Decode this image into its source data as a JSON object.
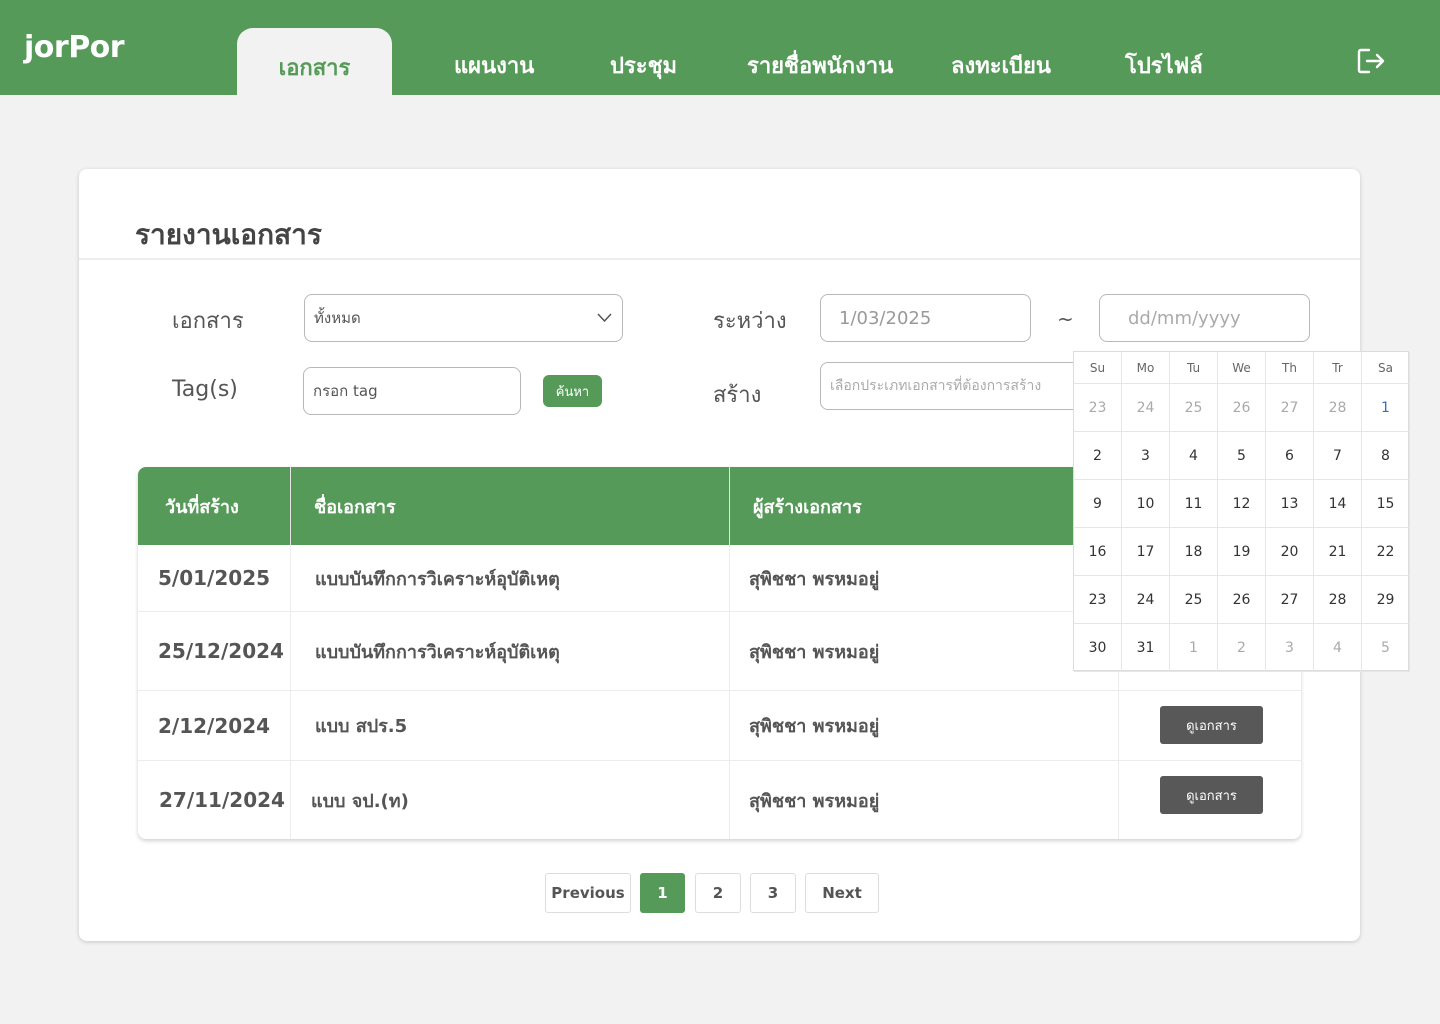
{
  "app": {
    "logo": "jorPor"
  },
  "nav": {
    "tabs": [
      {
        "label": "เอกสาร",
        "active": true
      },
      {
        "label": "แผนงาน"
      },
      {
        "label": "ประชุม"
      },
      {
        "label": "รายชื่อพนักงาน"
      },
      {
        "label": "ลงทะเบียน"
      },
      {
        "label": "โปรไฟล์"
      }
    ],
    "logout_icon": "logout-icon"
  },
  "page": {
    "title": "รายงานเอกสาร"
  },
  "filters": {
    "document_label": "เอกสาร",
    "document_value": "ทั้งหมด",
    "tags_label": "Tag(s)",
    "tags_placeholder": "กรอก tag",
    "search_button": "ค้นหา",
    "between_label": "ระหว่าง",
    "date_from": "1/03/2025",
    "separator": "~",
    "date_to_placeholder": "dd/mm/yyyy",
    "create_label": "สร้าง",
    "create_placeholder": "เลือกประเภทเอกสารที่ต้องการสร้าง"
  },
  "table": {
    "columns": [
      "วันที่สร้าง",
      "ชื่อเอกสาร",
      "ผู้สร้างเอกสาร"
    ],
    "view_button": "ดูเอกสาร",
    "rows": [
      {
        "date": "5/01/2025",
        "name": "แบบบันทึกการวิเคราะห์อุบัติเหตุ",
        "creator": "สุพิชชา พรหมอยู่"
      },
      {
        "date": "25/12/2024",
        "name": "แบบบันทึกการวิเคราะห์อุบัติเหตุ",
        "creator": "สุพิชชา พรหมอยู่"
      },
      {
        "date": "2/12/2024",
        "name": "แบบ สปร.5",
        "creator": "สุพิชชา พรหมอยู่"
      },
      {
        "date": "27/11/2024",
        "name": "แบบ จป.(ท)",
        "creator": "สุพิชชา พรหมอยู่"
      }
    ]
  },
  "pagination": {
    "previous": "Previous",
    "pages": [
      "1",
      "2",
      "3"
    ],
    "current": "1",
    "next": "Next"
  },
  "calendar": {
    "weekdays": [
      "Su",
      "Mo",
      "Tu",
      "We",
      "Th",
      "Tr",
      "Sa"
    ],
    "weeks": [
      [
        "23",
        "24",
        "25",
        "26",
        "27",
        "28",
        "1"
      ],
      [
        "2",
        "3",
        "4",
        "5",
        "6",
        "7",
        "8"
      ],
      [
        "9",
        "10",
        "11",
        "12",
        "13",
        "14",
        "15"
      ],
      [
        "16",
        "17",
        "18",
        "19",
        "20",
        "21",
        "22"
      ],
      [
        "23",
        "24",
        "25",
        "26",
        "27",
        "28",
        "29"
      ],
      [
        "30",
        "31",
        "1",
        "2",
        "3",
        "4",
        "5"
      ]
    ],
    "selected": "1"
  },
  "colors": {
    "brand": "#569a59",
    "background": "#f2f2f2",
    "button_dark": "#585858",
    "selected_day": "#2f6fc7"
  }
}
